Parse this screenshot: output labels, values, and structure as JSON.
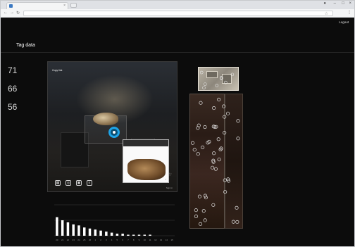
{
  "browser": {
    "tab_title": "",
    "url": "",
    "secure_label": ""
  },
  "app": {
    "title": "",
    "nav": {
      "brand": "",
      "management": "",
      "logout": "Logout"
    },
    "tabs": [
      {
        "label": ""
      },
      {
        "label": "Tag data",
        "active": true
      },
      {
        "label": ""
      }
    ]
  },
  "stats": {
    "heading": "",
    "date_range": "",
    "items": [
      {
        "label": "",
        "value": "71"
      },
      {
        "label": "",
        "value": "66"
      },
      {
        "label": "",
        "value": "56"
      }
    ]
  },
  "tour": {
    "presented_by": "",
    "name": "",
    "copy_link": "Copy link",
    "link_url": "",
    "info": "",
    "tag_card": {
      "title": "",
      "description": ""
    },
    "right_controls": [
      "",
      ""
    ],
    "footer": [
      "",
      "Sign in"
    ]
  },
  "chart_data": {
    "type": "bar",
    "categories": [
      "20",
      "21",
      "22",
      "23",
      "24",
      "25",
      "26",
      "1",
      "2",
      "3",
      "4",
      "5",
      "6",
      "7",
      "8",
      "9",
      "10",
      "11",
      "12",
      "13",
      "14",
      "15"
    ],
    "values": [
      18,
      15,
      13,
      11,
      10,
      8,
      7,
      6,
      5,
      4,
      3,
      2,
      2,
      1,
      1,
      1,
      1,
      1,
      0,
      0,
      0,
      0
    ],
    "ylim": [
      0,
      30
    ],
    "grid": true,
    "color": "#ffffff"
  },
  "plan": {
    "label_left": "",
    "label_right": "",
    "colors": {
      "marker": "#e6e6e6",
      "floor": "#2a1c16"
    }
  }
}
